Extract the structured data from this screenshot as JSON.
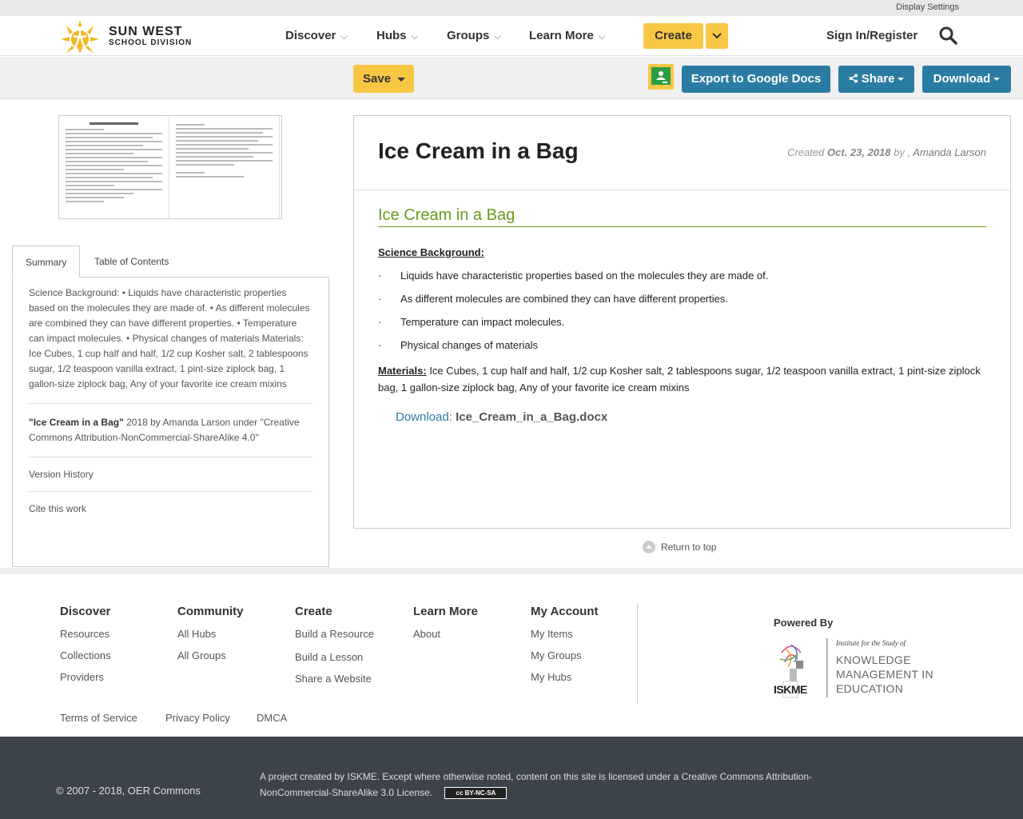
{
  "topbar": {
    "display_settings": "Display Settings"
  },
  "logo": {
    "line1": "SUN WEST",
    "line2": "SCHOOL DIVISION"
  },
  "nav": {
    "items": [
      {
        "label": "Discover"
      },
      {
        "label": "Hubs"
      },
      {
        "label": "Groups"
      },
      {
        "label": "Learn More"
      }
    ],
    "create": "Create",
    "signin": "Sign In/Register"
  },
  "toolbar": {
    "save": "Save",
    "export": "Export to Google Docs",
    "share": "Share",
    "download": "Download"
  },
  "sidebar": {
    "tabs": [
      "Summary",
      "Table of Contents"
    ],
    "summary": "Science Background: • Liquids have characteristic properties based on the molecules they are made of. • As different molecules are combined they can have different properties. • Temperature can impact molecules. • Physical changes of materials Materials: Ice Cubes, 1 cup half and half, 1/2 cup Kosher salt, 2 tablespoons sugar, 1/2 teaspoon vanilla extract, 1 pint-size ziplock bag, 1 gallon-size ziplock bag, Any of your favorite ice cream mixins",
    "attribution_title": "\"Ice Cream in a Bag\"",
    "attribution_rest": " 2018 by Amanda Larson under \"Creative Commons Attribution-NonCommercial-ShareAlike 4.0\"",
    "version_history": "Version History",
    "cite": "Cite this work"
  },
  "main": {
    "title": "Ice Cream in a Bag",
    "created_label": "Created",
    "created_date": "Oct. 23, 2018",
    "by": "by ,",
    "author": "Amanda Larson",
    "heading": "Ice Cream in a Bag",
    "science_label": "Science Background:",
    "bullets": [
      "Liquids have characteristic properties based on the molecules they are made of.",
      "As different molecules are combined they can have different properties.",
      "Temperature can impact molecules.",
      "Physical changes of materials"
    ],
    "bullet_char": "·",
    "materials_label": "Materials:",
    "materials_text": " Ice Cubes, 1 cup half and half, 1/2 cup Kosher salt, 2 tablespoons sugar, 1/2 teaspoon vanilla extract, 1 pint-size ziplock bag, 1 gallon-size ziplock bag, Any of your favorite ice cream mixins",
    "download_label": "Download:",
    "download_file": "Ice_Cream_in_a_Bag.docx"
  },
  "return_top": "Return to top",
  "footer": {
    "columns": [
      {
        "title": "Discover",
        "links": [
          "Resources",
          "Collections",
          "Providers"
        ]
      },
      {
        "title": "Community",
        "links": [
          "All Hubs",
          "All Groups"
        ]
      },
      {
        "title": "Create",
        "links": [
          "Build a Resource",
          "Build a Lesson",
          "Share a Website"
        ]
      },
      {
        "title": "Learn More",
        "links": [
          "About"
        ]
      },
      {
        "title": "My Account",
        "links": [
          "My Items",
          "My Groups",
          "My Hubs"
        ]
      }
    ],
    "powered_by": "Powered By",
    "iskme_lines": [
      "Institute for the Study of",
      "KNOWLEDGE",
      "MANAGEMENT IN",
      "EDUCATION"
    ],
    "iskme_mark": "ISKME",
    "legal": [
      "Terms of Service",
      "Privacy Policy",
      "DMCA"
    ]
  },
  "bottom": {
    "copyright": "© 2007 - 2018, OER Commons",
    "project": "A project created by ISKME. Except where otherwise noted, content on this site is licensed under a Creative Commons Attribution-NonCommercial-ShareAlike 3.0 License.",
    "cc_badge": "cc BY-NC-SA"
  },
  "colors": {
    "accent_yellow": "#f7c744",
    "accent_blue": "#2b7ca3",
    "heading_green": "#6a9a1f",
    "footer_dark": "#3d434b"
  }
}
